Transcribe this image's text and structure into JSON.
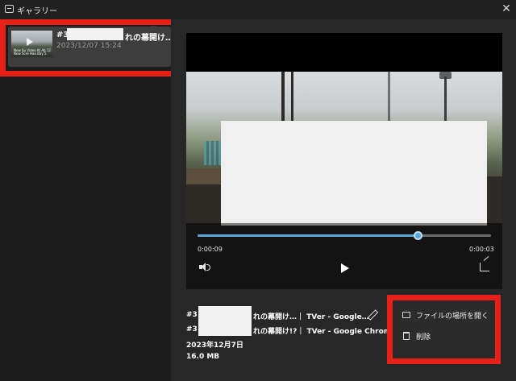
{
  "window": {
    "title": "ギャラリー",
    "close_glyph": "✕"
  },
  "sidebar": {
    "folder_icon": "folder-icon",
    "items": [
      {
        "number": "#3",
        "title_tail": "れの幕開け…",
        "date": "2023/12/07 15:24",
        "thumb_caption": "Now Su Video At Ab 12\nNow Scre Hao Bay 5"
      }
    ]
  },
  "player": {
    "current_time": "0:00:09",
    "remaining_time": "0:00:03",
    "progress": 0.75,
    "icons": {
      "volume": "volume-icon",
      "play": "play-icon",
      "share": "share-icon"
    }
  },
  "info": {
    "line1_prefix": "#3",
    "line1_suffix": "れの幕開け…｜ TVer - Google…",
    "line2_prefix": "#3",
    "line2_suffix": "れの幕開け!?｜ TVer - Google Chrome",
    "date": "2023年12月7日",
    "size": "16.0 MB"
  },
  "context_menu": {
    "items": [
      {
        "label": "ファイルの場所を開く",
        "icon": "folder-icon"
      },
      {
        "label": "削除",
        "icon": "trash-icon"
      }
    ]
  },
  "colors": {
    "highlight": "#e8201a",
    "accent": "#58a8d8"
  }
}
